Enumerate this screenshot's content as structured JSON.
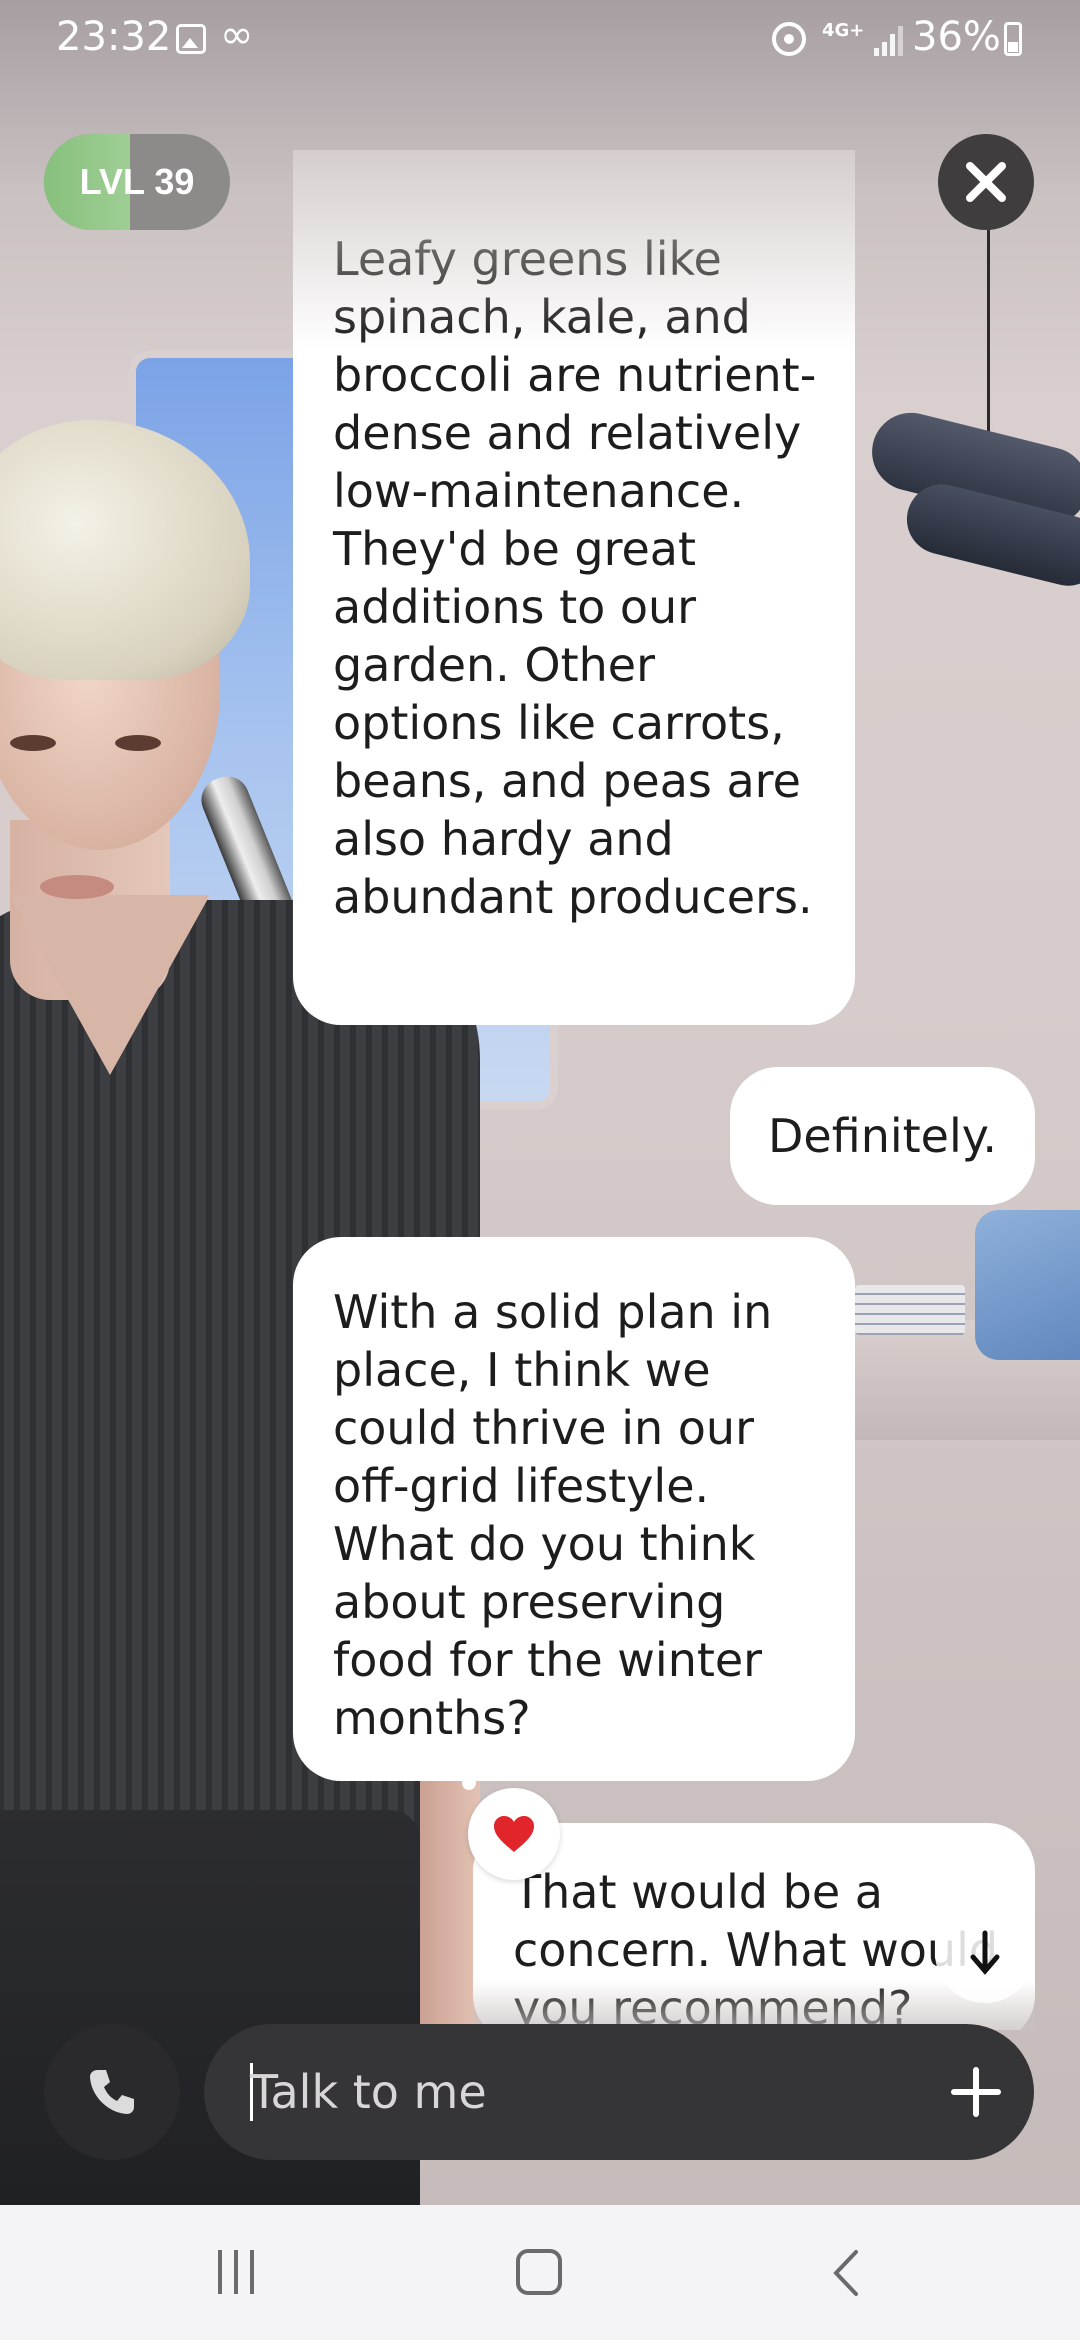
{
  "status_bar": {
    "time": "23:32",
    "network": "4G+",
    "battery": "36%",
    "icons": [
      "gallery-icon",
      "infinity-icon",
      "hotspot-icon",
      "signal-icon",
      "battery-icon"
    ]
  },
  "level": {
    "label": "LVL 39",
    "progress": 0.46,
    "fill_color": "#9fce95"
  },
  "close": {
    "icon": "close-icon"
  },
  "messages": [
    {
      "sender": "avatar",
      "text": "Leafy greens like spinach, kale, and broccoli are nutrient-dense and relatively low-maintenance. They'd be great additions to our garden. Other options like carrots, beans, and peas are also hardy and abundant producers."
    },
    {
      "sender": "user",
      "text": "Definitely."
    },
    {
      "sender": "avatar",
      "text": "With a solid plan in place, I think we could thrive in our off-grid lifestyle. What do you think about preserving food for the winter months?"
    },
    {
      "sender": "user",
      "text": "That would be a concern. What would you recommend?",
      "reaction": "heart-icon"
    }
  ],
  "input": {
    "placeholder": "Talk to me",
    "call_icon": "phone-icon",
    "add_icon": "plus-icon"
  },
  "scroll": {
    "icon": "arrow-down-icon"
  },
  "nav": {
    "icons": [
      "recents-icon",
      "home-icon",
      "back-icon"
    ]
  },
  "colors": {
    "bubble": "#ffffff",
    "input_bar": "#353436",
    "close_button": "#3f3d3d",
    "reaction_heart": "#e0262b"
  }
}
